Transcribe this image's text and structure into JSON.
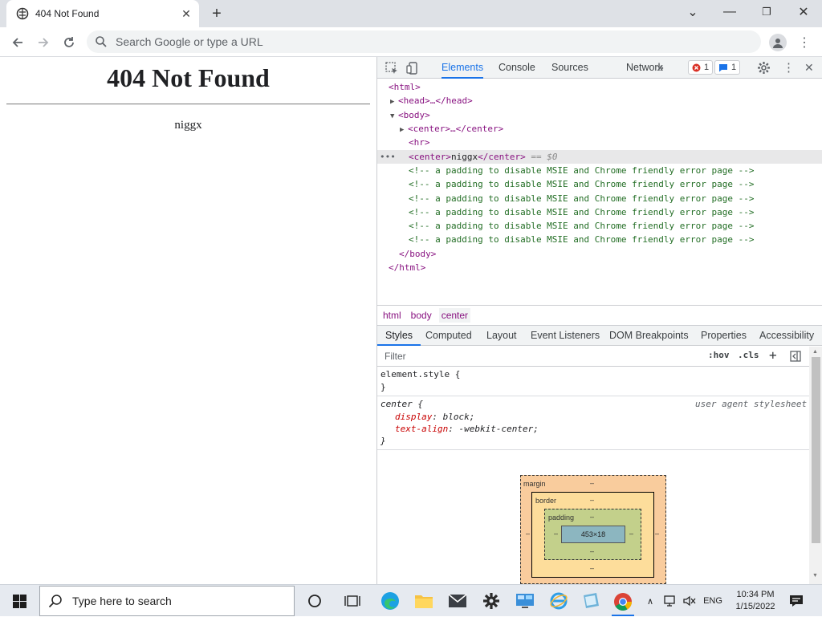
{
  "browser": {
    "tab_title": "404 Not Found",
    "tab_close": "✕",
    "new_tab": "+",
    "omnibox_placeholder": "Search Google or type a URL",
    "window": {
      "minimize": "—",
      "restore": "❐",
      "close": "✕",
      "tabsearch": "⌄"
    }
  },
  "page": {
    "heading": "404 Not Found",
    "server": "niggx"
  },
  "devtools": {
    "tabs": [
      "Elements",
      "Console",
      "Sources",
      "Network"
    ],
    "more": "»",
    "errors_count": "1",
    "messages_count": "1",
    "dom": {
      "html_open": "<html>",
      "head": "<head>…</head>",
      "body_open": "<body>",
      "center_collapsed": "<center>…</center>",
      "hr": "<hr>",
      "center_open": "<center>",
      "center_text": "niggx",
      "center_close": "</center>",
      "selected_marker": "== $0",
      "comment": "<!-- a padding to disable MSIE and Chrome friendly error page -->",
      "body_close": "</body>",
      "html_close": "</html>"
    },
    "breadcrumbs": [
      "html",
      "body",
      "center"
    ],
    "styles_tabs": [
      "Styles",
      "Computed",
      "Layout",
      "Event Listeners",
      "DOM Breakpoints",
      "Properties",
      "Accessibility"
    ],
    "filter_placeholder": "Filter",
    "hov": ":hov",
    "cls": ".cls",
    "rules": {
      "element_style": "element.style {",
      "close_brace": "}",
      "center_selector": "center {",
      "ua_label": "user agent stylesheet",
      "prop1": "display",
      "val1": "block;",
      "prop2": "text-align",
      "val2": "-webkit-center;"
    },
    "boxmodel": {
      "margin": "margin",
      "border": "border",
      "padding": "padding",
      "dash": "–",
      "content": "453×18"
    }
  },
  "taskbar": {
    "search_placeholder": "Type here to search",
    "language": "ENG",
    "time": "10:34 PM",
    "date": "1/15/2022"
  },
  "colors": {
    "accent": "#1a73e8",
    "margin": "#f9cc9d",
    "border": "#fddd9b",
    "padding": "#c3d08b",
    "content": "#8cb6c0"
  }
}
